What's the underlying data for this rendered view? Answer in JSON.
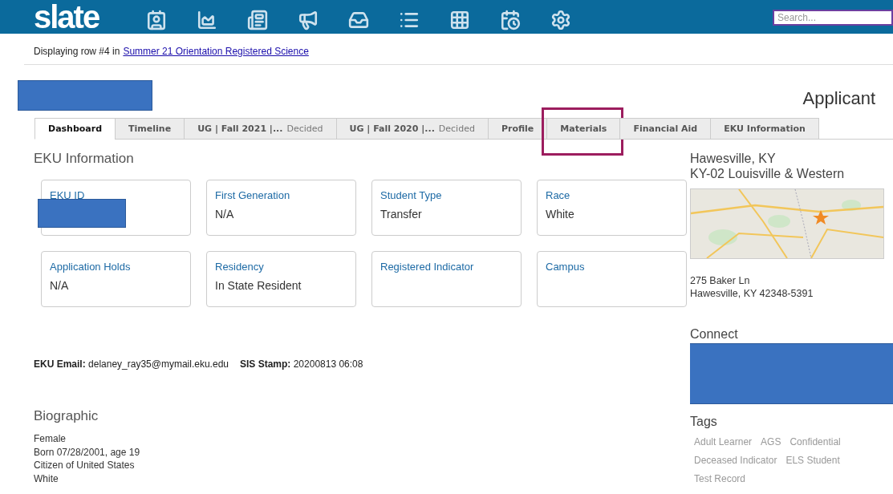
{
  "header": {
    "logo": "slate",
    "search": {
      "placeholder": "Search..."
    }
  },
  "breadcrumb": {
    "prefix": "Displaying row #4 in",
    "link": "Summer 21 Orientation Registered Science"
  },
  "record": {
    "name_redacted": true,
    "type": "Applicant"
  },
  "tabs": [
    {
      "label": "Dashboard",
      "selected": true,
      "highlighted": false
    },
    {
      "label": "Timeline",
      "selected": false,
      "highlighted": false
    },
    {
      "label": "UG | Fall 2021 |...",
      "suffix": "Decided",
      "selected": false,
      "highlighted": false
    },
    {
      "label": "UG | Fall 2020 |...",
      "suffix": "Decided",
      "selected": false,
      "highlighted": false
    },
    {
      "label": "Profile",
      "selected": false,
      "highlighted": false
    },
    {
      "label": "Materials",
      "selected": false,
      "highlighted": true
    },
    {
      "label": "Financial Aid",
      "selected": false,
      "highlighted": false
    },
    {
      "label": "EKU Information",
      "selected": false,
      "highlighted": false
    }
  ],
  "eku_information": {
    "title": "EKU Information",
    "cards": [
      {
        "label": "EKU ID",
        "redacted": true
      },
      {
        "label": "First Generation",
        "value": "N/A",
        "redacted": false
      },
      {
        "label": "Student Type",
        "value": "Transfer",
        "redacted": false
      },
      {
        "label": "Race",
        "value": "White",
        "redacted": false
      },
      {
        "label": "Application Holds",
        "value": "N/A",
        "redacted": false
      },
      {
        "label": "Residency",
        "value": "In State Resident",
        "redacted": false
      },
      {
        "label": "Registered Indicator",
        "redacted": false
      },
      {
        "label": "Campus",
        "redacted": false
      }
    ]
  },
  "stamps": [
    {
      "label": "EKU Email:",
      "value": "delaney_ray35@mymail.eku.edu"
    },
    {
      "label": "SIS Stamp:",
      "value": "20200813 06:08"
    }
  ],
  "biographic": {
    "title": "Biographic",
    "lines": [
      "Female",
      "Born 07/28/2001, age 19",
      "Citizen of United States",
      "White"
    ]
  },
  "location": {
    "city": "Hawesville, KY",
    "district": "KY-02 Louisville & Western",
    "address": [
      "275 Baker Ln",
      "Hawesville, KY 42348-5391"
    ]
  },
  "connect": {
    "title": "Connect",
    "redacted": true
  },
  "tags": {
    "title": "Tags",
    "items": [
      "Adult Learner",
      "AGS",
      "Confidential",
      "Deceased Indicator",
      "ELS Student",
      "Test Record"
    ]
  }
}
